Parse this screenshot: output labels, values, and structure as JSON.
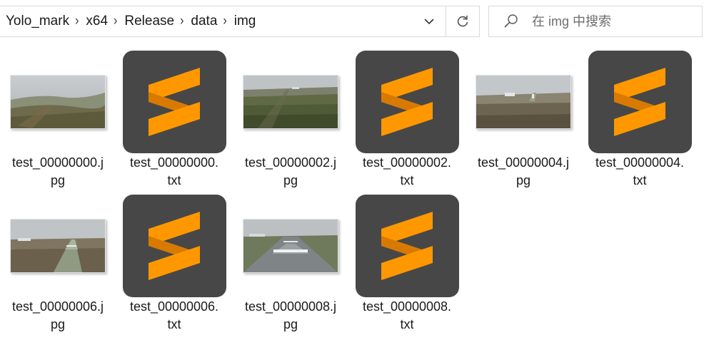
{
  "address_bar": {
    "breadcrumbs": [
      "Yolo_mark",
      "x64",
      "Release",
      "data",
      "img"
    ]
  },
  "search": {
    "placeholder": "在 img 中搜索"
  },
  "files": [
    {
      "name_line1": "test_00000000.j",
      "name_line2": "pg",
      "kind": "photo",
      "scene": "field-haze"
    },
    {
      "name_line1": "test_00000000.",
      "name_line2": "txt",
      "kind": "sublime-text-icon"
    },
    {
      "name_line1": "test_00000002.j",
      "name_line2": "pg",
      "kind": "photo",
      "scene": "field-approach"
    },
    {
      "name_line1": "test_00000002.",
      "name_line2": "txt",
      "kind": "sublime-text-icon"
    },
    {
      "name_line1": "test_00000004.j",
      "name_line2": "pg",
      "kind": "photo",
      "scene": "runway-far"
    },
    {
      "name_line1": "test_00000004.",
      "name_line2": "txt",
      "kind": "sublime-text-icon"
    },
    {
      "name_line1": "test_00000006.j",
      "name_line2": "pg",
      "kind": "photo",
      "scene": "runway-mid"
    },
    {
      "name_line1": "test_00000006.",
      "name_line2": "txt",
      "kind": "sublime-text-icon"
    },
    {
      "name_line1": "test_00000008.j",
      "name_line2": "pg",
      "kind": "photo",
      "scene": "runway-near"
    },
    {
      "name_line1": "test_00000008.",
      "name_line2": "txt",
      "kind": "sublime-text-icon"
    }
  ],
  "colors": {
    "sublime_bg": "#474747",
    "sublime_orange": "#ff9800",
    "border": "#d9d9d9"
  }
}
